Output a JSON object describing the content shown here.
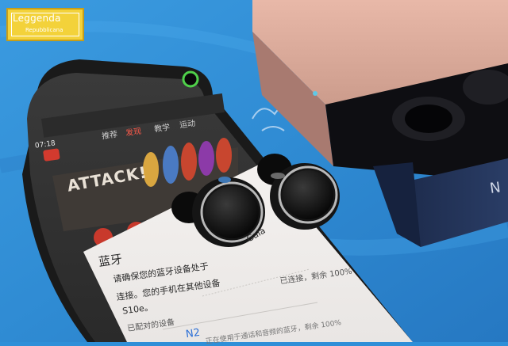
{
  "watermark": {
    "title": "Leggenda",
    "subtitle": "Repubblicana"
  },
  "phone": {
    "status_time": "07:18",
    "tabs": [
      "推荐",
      "发现",
      "教学",
      "运动"
    ],
    "banner": {
      "text": "ATTACK!"
    }
  },
  "dialog": {
    "title": "蓝牙",
    "body_line1": "请确保您的蓝牙设备处于",
    "body_line2": "连接。您的手机在其他设备",
    "body_line3": "S10e。",
    "trail_text": "Gala",
    "section_label": "已配对的设备",
    "device_name": "N2",
    "device_status": "已连接，剩余 100%",
    "device_detail": "正在使用于通话和音频的蓝牙，剩余 100%"
  },
  "case_brand": "N"
}
